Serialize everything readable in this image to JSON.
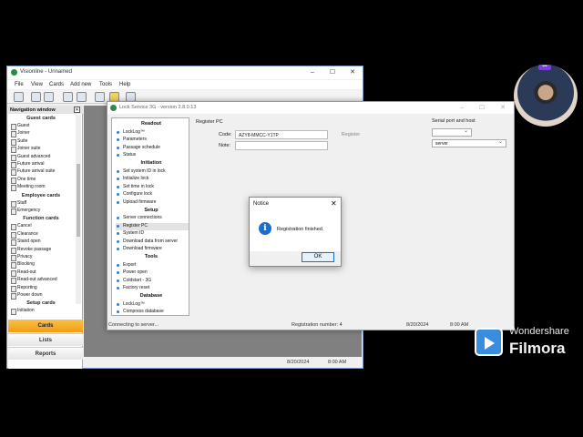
{
  "visionline": {
    "title": "Visionline - Unnamed",
    "menu": [
      "File",
      "View",
      "Cards",
      "Add new",
      "Tools",
      "Help"
    ],
    "nav_title": "Navigation window",
    "sections": [
      {
        "header": "Guest cards",
        "items": [
          "Guest",
          "Joiner",
          "Suite",
          "Joiner suite",
          "Guest advanced",
          "Future arrival",
          "Future arrival suite",
          "One time",
          "Meeting room"
        ]
      },
      {
        "header": "Employee cards",
        "items": [
          "Staff",
          "Emergency"
        ]
      },
      {
        "header": "Function cards",
        "items": [
          "Cancel",
          "Clearance",
          "Stand open",
          "Revoke passage",
          "Privacy",
          "Blocking",
          "Read-out",
          "Read-out advanced",
          "Reporting",
          "Power down"
        ]
      },
      {
        "header": "Setup cards",
        "items": [
          "Initiation"
        ]
      }
    ],
    "bottom_buttons": {
      "cards": "Cards",
      "lists": "Lists",
      "reports": "Reports"
    },
    "status_date": "8/20/2024",
    "status_time": "8:00 AM"
  },
  "lockservice": {
    "title": "Lock Service 3G - version 2.8.0.13",
    "menu_sections": [
      {
        "header": "Readout",
        "items": [
          "LockLog™",
          "Parameters",
          "Passage schedule",
          "Status"
        ]
      },
      {
        "header": "Initiation",
        "items": [
          "Set system ID in lock",
          "Initialize lock",
          "Set time in lock",
          "Configure lock",
          "Upload firmware"
        ]
      },
      {
        "header": "Setup",
        "items": [
          "Server connections",
          "Register PC",
          "System ID",
          "Download data from server",
          "Download firmware"
        ]
      },
      {
        "header": "Tools",
        "items": [
          "Export",
          "Power open",
          "Coldstart - 3G",
          "Factory reset"
        ]
      },
      {
        "header": "Database",
        "items": [
          "LockLog™",
          "Compress database"
        ]
      }
    ],
    "selected_item": "Register PC",
    "panel_title": "Register PC",
    "code_label": "Code:",
    "code_value": "AZY8-MMCC-Y1TP",
    "note_label": "Note:",
    "note_value": "",
    "register_button": "Register",
    "serial_title": "Serial port and host",
    "serial_port_value": "",
    "host_value": "server",
    "status_connecting": "Connecting to server...",
    "status_registration": "Registration number: 4",
    "status_date": "8/20/2024",
    "status_time": "8:00 AM"
  },
  "notice": {
    "title": "Notice",
    "message": "Registration finished.",
    "ok_label": "OK",
    "icon": "info-icon"
  },
  "watermark": {
    "brand_small": "Wondershare",
    "brand_big": "Filmora"
  },
  "colors": {
    "cards_button": "#f39c12",
    "info_blue": "#1c6dd0",
    "filmora_blue": "#3a8dde"
  }
}
